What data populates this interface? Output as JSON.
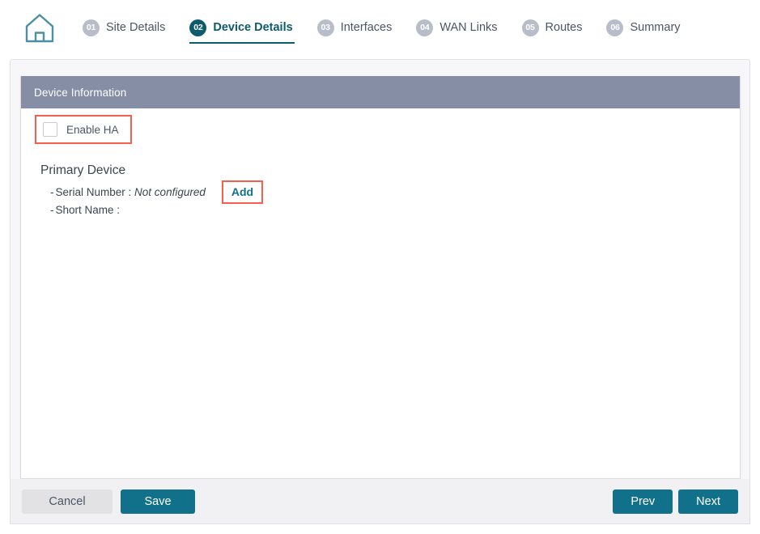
{
  "wizard": {
    "home_icon": "home-icon",
    "steps": [
      {
        "number": "01",
        "label": "Site Details",
        "active": false
      },
      {
        "number": "02",
        "label": "Device Details",
        "active": true
      },
      {
        "number": "03",
        "label": "Interfaces",
        "active": false
      },
      {
        "number": "04",
        "label": "WAN Links",
        "active": false
      },
      {
        "number": "05",
        "label": "Routes",
        "active": false
      },
      {
        "number": "06",
        "label": "Summary",
        "active": false
      }
    ]
  },
  "panel": {
    "title": "Device Information",
    "enable_ha": {
      "label": "Enable HA",
      "checked": false
    },
    "primary_device": {
      "title": "Primary Device",
      "serial_number": {
        "dash": "-",
        "label": "Serial Number : ",
        "value": "Not configured",
        "add_label": "Add"
      },
      "short_name": {
        "dash": "-",
        "label": "Short Name :",
        "value": ""
      }
    }
  },
  "footer": {
    "cancel_label": "Cancel",
    "save_label": "Save",
    "prev_label": "Prev",
    "next_label": "Next"
  },
  "colors": {
    "teal": "#11718a",
    "teal_dark": "#0d5c6e",
    "header_grey": "#868ea6",
    "annotation_red": "#f4604c",
    "badge_grey": "#b7bdc9",
    "text": "#4c5564"
  }
}
